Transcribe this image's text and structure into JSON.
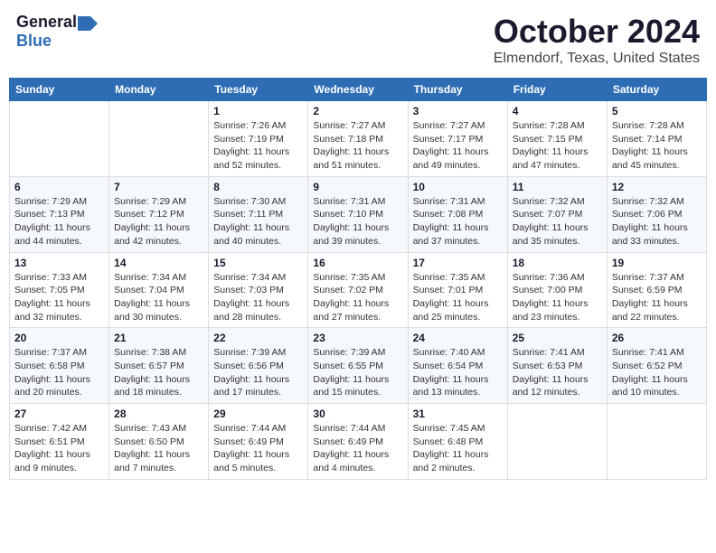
{
  "logo": {
    "general": "General",
    "blue": "Blue"
  },
  "title": "October 2024",
  "subtitle": "Elmendorf, Texas, United States",
  "headers": [
    "Sunday",
    "Monday",
    "Tuesday",
    "Wednesday",
    "Thursday",
    "Friday",
    "Saturday"
  ],
  "weeks": [
    [
      {
        "day": "",
        "sunrise": "",
        "sunset": "",
        "daylight": ""
      },
      {
        "day": "",
        "sunrise": "",
        "sunset": "",
        "daylight": ""
      },
      {
        "day": "1",
        "sunrise": "Sunrise: 7:26 AM",
        "sunset": "Sunset: 7:19 PM",
        "daylight": "Daylight: 11 hours and 52 minutes."
      },
      {
        "day": "2",
        "sunrise": "Sunrise: 7:27 AM",
        "sunset": "Sunset: 7:18 PM",
        "daylight": "Daylight: 11 hours and 51 minutes."
      },
      {
        "day": "3",
        "sunrise": "Sunrise: 7:27 AM",
        "sunset": "Sunset: 7:17 PM",
        "daylight": "Daylight: 11 hours and 49 minutes."
      },
      {
        "day": "4",
        "sunrise": "Sunrise: 7:28 AM",
        "sunset": "Sunset: 7:15 PM",
        "daylight": "Daylight: 11 hours and 47 minutes."
      },
      {
        "day": "5",
        "sunrise": "Sunrise: 7:28 AM",
        "sunset": "Sunset: 7:14 PM",
        "daylight": "Daylight: 11 hours and 45 minutes."
      }
    ],
    [
      {
        "day": "6",
        "sunrise": "Sunrise: 7:29 AM",
        "sunset": "Sunset: 7:13 PM",
        "daylight": "Daylight: 11 hours and 44 minutes."
      },
      {
        "day": "7",
        "sunrise": "Sunrise: 7:29 AM",
        "sunset": "Sunset: 7:12 PM",
        "daylight": "Daylight: 11 hours and 42 minutes."
      },
      {
        "day": "8",
        "sunrise": "Sunrise: 7:30 AM",
        "sunset": "Sunset: 7:11 PM",
        "daylight": "Daylight: 11 hours and 40 minutes."
      },
      {
        "day": "9",
        "sunrise": "Sunrise: 7:31 AM",
        "sunset": "Sunset: 7:10 PM",
        "daylight": "Daylight: 11 hours and 39 minutes."
      },
      {
        "day": "10",
        "sunrise": "Sunrise: 7:31 AM",
        "sunset": "Sunset: 7:08 PM",
        "daylight": "Daylight: 11 hours and 37 minutes."
      },
      {
        "day": "11",
        "sunrise": "Sunrise: 7:32 AM",
        "sunset": "Sunset: 7:07 PM",
        "daylight": "Daylight: 11 hours and 35 minutes."
      },
      {
        "day": "12",
        "sunrise": "Sunrise: 7:32 AM",
        "sunset": "Sunset: 7:06 PM",
        "daylight": "Daylight: 11 hours and 33 minutes."
      }
    ],
    [
      {
        "day": "13",
        "sunrise": "Sunrise: 7:33 AM",
        "sunset": "Sunset: 7:05 PM",
        "daylight": "Daylight: 11 hours and 32 minutes."
      },
      {
        "day": "14",
        "sunrise": "Sunrise: 7:34 AM",
        "sunset": "Sunset: 7:04 PM",
        "daylight": "Daylight: 11 hours and 30 minutes."
      },
      {
        "day": "15",
        "sunrise": "Sunrise: 7:34 AM",
        "sunset": "Sunset: 7:03 PM",
        "daylight": "Daylight: 11 hours and 28 minutes."
      },
      {
        "day": "16",
        "sunrise": "Sunrise: 7:35 AM",
        "sunset": "Sunset: 7:02 PM",
        "daylight": "Daylight: 11 hours and 27 minutes."
      },
      {
        "day": "17",
        "sunrise": "Sunrise: 7:35 AM",
        "sunset": "Sunset: 7:01 PM",
        "daylight": "Daylight: 11 hours and 25 minutes."
      },
      {
        "day": "18",
        "sunrise": "Sunrise: 7:36 AM",
        "sunset": "Sunset: 7:00 PM",
        "daylight": "Daylight: 11 hours and 23 minutes."
      },
      {
        "day": "19",
        "sunrise": "Sunrise: 7:37 AM",
        "sunset": "Sunset: 6:59 PM",
        "daylight": "Daylight: 11 hours and 22 minutes."
      }
    ],
    [
      {
        "day": "20",
        "sunrise": "Sunrise: 7:37 AM",
        "sunset": "Sunset: 6:58 PM",
        "daylight": "Daylight: 11 hours and 20 minutes."
      },
      {
        "day": "21",
        "sunrise": "Sunrise: 7:38 AM",
        "sunset": "Sunset: 6:57 PM",
        "daylight": "Daylight: 11 hours and 18 minutes."
      },
      {
        "day": "22",
        "sunrise": "Sunrise: 7:39 AM",
        "sunset": "Sunset: 6:56 PM",
        "daylight": "Daylight: 11 hours and 17 minutes."
      },
      {
        "day": "23",
        "sunrise": "Sunrise: 7:39 AM",
        "sunset": "Sunset: 6:55 PM",
        "daylight": "Daylight: 11 hours and 15 minutes."
      },
      {
        "day": "24",
        "sunrise": "Sunrise: 7:40 AM",
        "sunset": "Sunset: 6:54 PM",
        "daylight": "Daylight: 11 hours and 13 minutes."
      },
      {
        "day": "25",
        "sunrise": "Sunrise: 7:41 AM",
        "sunset": "Sunset: 6:53 PM",
        "daylight": "Daylight: 11 hours and 12 minutes."
      },
      {
        "day": "26",
        "sunrise": "Sunrise: 7:41 AM",
        "sunset": "Sunset: 6:52 PM",
        "daylight": "Daylight: 11 hours and 10 minutes."
      }
    ],
    [
      {
        "day": "27",
        "sunrise": "Sunrise: 7:42 AM",
        "sunset": "Sunset: 6:51 PM",
        "daylight": "Daylight: 11 hours and 9 minutes."
      },
      {
        "day": "28",
        "sunrise": "Sunrise: 7:43 AM",
        "sunset": "Sunset: 6:50 PM",
        "daylight": "Daylight: 11 hours and 7 minutes."
      },
      {
        "day": "29",
        "sunrise": "Sunrise: 7:44 AM",
        "sunset": "Sunset: 6:49 PM",
        "daylight": "Daylight: 11 hours and 5 minutes."
      },
      {
        "day": "30",
        "sunrise": "Sunrise: 7:44 AM",
        "sunset": "Sunset: 6:49 PM",
        "daylight": "Daylight: 11 hours and 4 minutes."
      },
      {
        "day": "31",
        "sunrise": "Sunrise: 7:45 AM",
        "sunset": "Sunset: 6:48 PM",
        "daylight": "Daylight: 11 hours and 2 minutes."
      },
      {
        "day": "",
        "sunrise": "",
        "sunset": "",
        "daylight": ""
      },
      {
        "day": "",
        "sunrise": "",
        "sunset": "",
        "daylight": ""
      }
    ]
  ]
}
